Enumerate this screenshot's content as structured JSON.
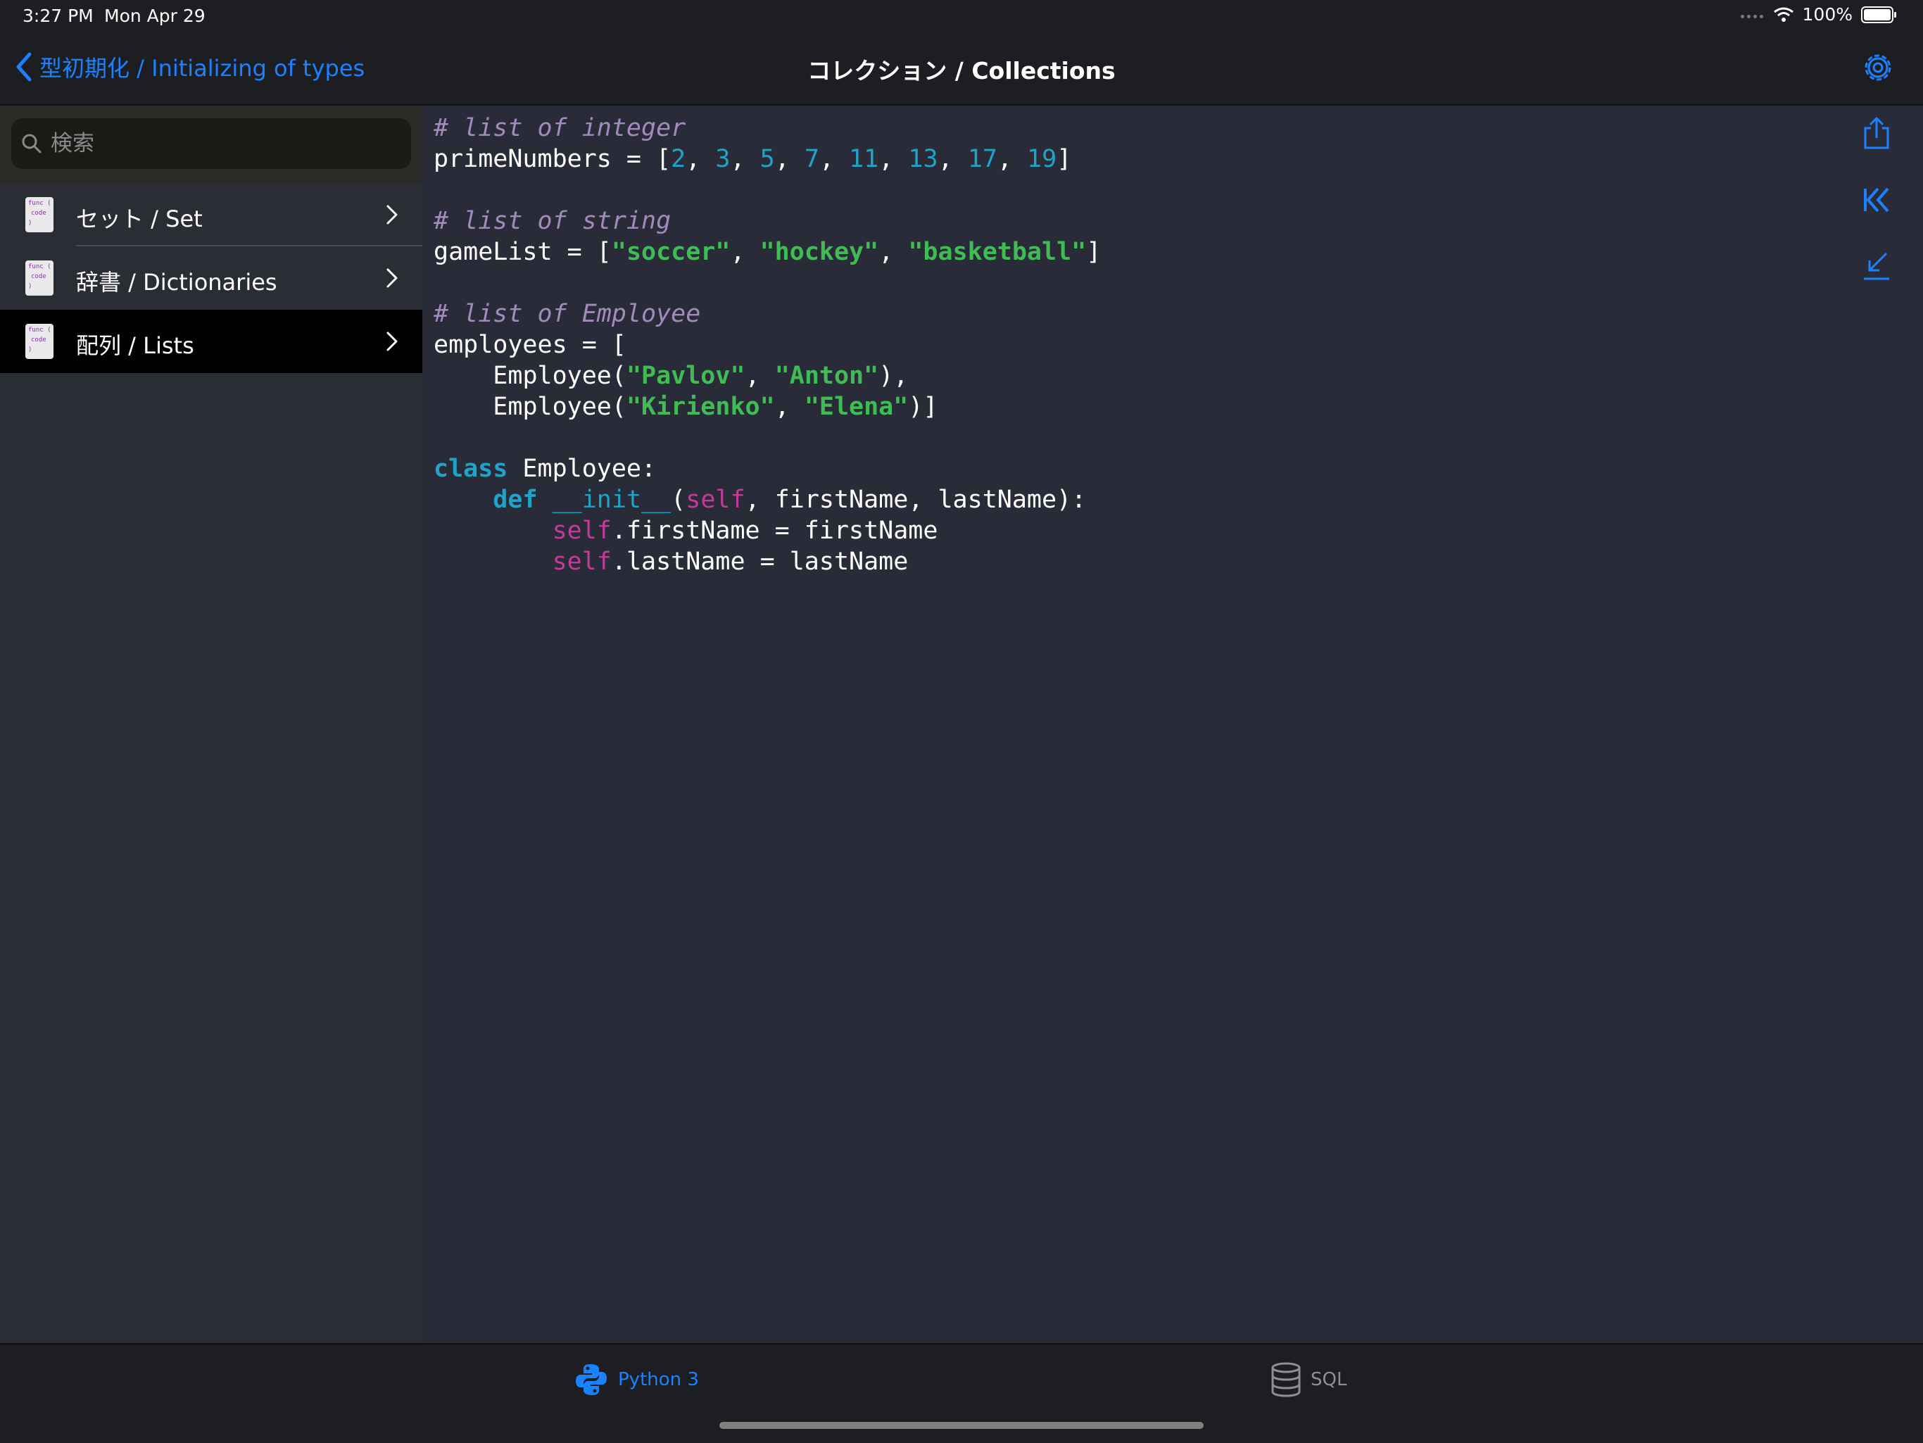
{
  "status_bar": {
    "time": "3:27 PM",
    "date": "Mon Apr 29",
    "battery": "100%"
  },
  "nav": {
    "back_label": "型初期化 / Initializing of types",
    "title": "コレクション / Collections"
  },
  "search": {
    "placeholder": "検索"
  },
  "sidebar": {
    "items": [
      {
        "label": "セット / Set",
        "selected": false
      },
      {
        "label": "辞書 / Dictionaries",
        "selected": false
      },
      {
        "label": "配列 / Lists",
        "selected": true
      }
    ],
    "thumb_text": [
      "func (",
      "code",
      ")"
    ]
  },
  "code": {
    "c1": "# list of integer",
    "l1_name": "primeNumbers = [",
    "nums": [
      "2",
      "3",
      "5",
      "7",
      "11",
      "13",
      "17",
      "19"
    ],
    "c2": "# list of string",
    "l2_name": "gameList = [",
    "games": [
      "\"soccer\"",
      "\"hockey\"",
      "\"basketball\""
    ],
    "c3": "# list of Employee",
    "l3": "employees = [",
    "emp": "Employee(",
    "e1a": "\"Pavlov\"",
    "e1b": "\"Anton\"",
    "e2a": "\"Kirienko\"",
    "e2b": "\"Elena\"",
    "kw_class": "class",
    "class_name": " Employee:",
    "kw_def": "def",
    "init": "__init__",
    "self": "self",
    "params": ", firstName, lastName):",
    "line_first": ".firstName = firstName",
    "line_last": ".lastName = lastName"
  },
  "tabs": [
    {
      "label": "Python 3",
      "active": true
    },
    {
      "label": "SQL",
      "active": false
    }
  ],
  "colors": {
    "accent": "#1a82ff",
    "comment": "#a38abc",
    "number": "#1fa3c7",
    "string": "#3fbc54",
    "self": "#c23b9a",
    "background": "#292c38"
  }
}
